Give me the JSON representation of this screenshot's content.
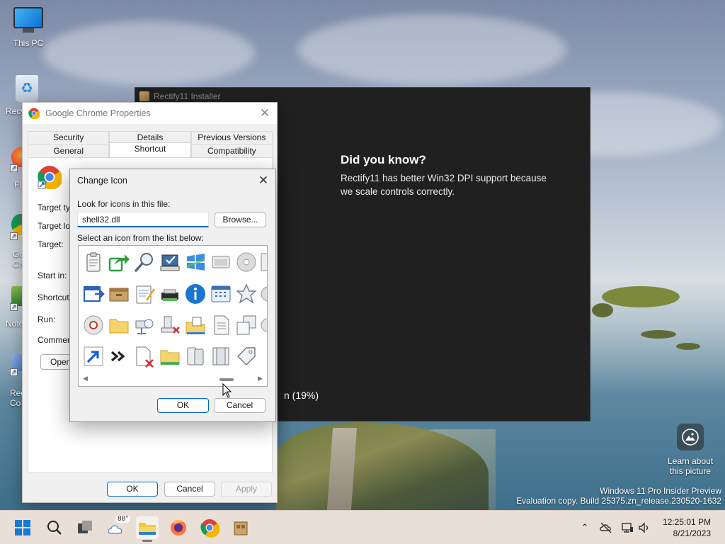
{
  "desktop": {
    "icons": [
      {
        "label": "This PC"
      },
      {
        "label": "Recy"
      },
      {
        "label": "Fi"
      },
      {
        "label": "Go Chr"
      },
      {
        "label": "Note"
      },
      {
        "label": "Rec Co"
      }
    ],
    "learn_about": "Learn about this picture",
    "watermark_line1": "Windows 11 Pro Insider Preview",
    "watermark_line2": "Evaluation copy. Build 25375.zn_release.230520-1632"
  },
  "installer": {
    "title": "Rectify11 Installer",
    "heading": "Did you know?",
    "body": "Rectify11 has better Win32 DPI support because we scale controls correctly.",
    "progress_text": "n (19%)",
    "progress_percent": 19
  },
  "properties": {
    "title": "Google Chrome Properties",
    "tabs_row1": [
      "Security",
      "Details",
      "Previous Versions"
    ],
    "tabs_row2": [
      "General",
      "Shortcut",
      "Compatibility"
    ],
    "active_tab": "Shortcut",
    "labels": {
      "target_type": "Target typ",
      "target_location": "Target loc",
      "target": "Target:",
      "start_in": "Start in:",
      "shortcut_key": "Shortcut k",
      "run": "Run:",
      "comment": "Comment:"
    },
    "open_button": "Open",
    "ok": "OK",
    "cancel": "Cancel",
    "apply": "Apply"
  },
  "change_icon": {
    "title": "Change Icon",
    "look_for_label": "Look for icons in this file:",
    "file_value": "shell32.dll",
    "browse": "Browse...",
    "select_label": "Select an icon from the list below:",
    "ok": "OK",
    "cancel": "Cancel",
    "icons": [
      "clipboard-icon",
      "share-arrow-icon",
      "magnifier-icon",
      "computer-check-icon",
      "windows-logo-icon",
      "window-frame-icon",
      "cd-icon",
      "partial-icon",
      "window-arrow-icon",
      "archive-box-icon",
      "notepad-icon",
      "printer-icon",
      "info-icon",
      "calendar-grid-icon",
      "star-icon",
      "partial-icon",
      "disc-drive-icon",
      "folder-icon",
      "network-printer-icon",
      "user-x-icon",
      "folder-document-icon",
      "document-icon",
      "windows-overlap-icon",
      "partial-icon",
      "shortcut-arrow-icon",
      "chevrons-icon",
      "document-x-icon",
      "folder-open-icon",
      "users-icon",
      "panel-icon",
      "tag-icon"
    ]
  },
  "taskbar": {
    "weather_temp": "88°",
    "time": "12:25:01 PM",
    "date": "8/21/2023",
    "apps": [
      "start-icon",
      "search-icon",
      "task-view-icon",
      "weather-icon",
      "file-explorer-icon",
      "firefox-icon",
      "chrome-icon",
      "installer-icon"
    ]
  },
  "colors": {
    "accent": "#0067c0",
    "installer_bg": "#202020",
    "taskbar_bg": "#e9dfd7"
  }
}
